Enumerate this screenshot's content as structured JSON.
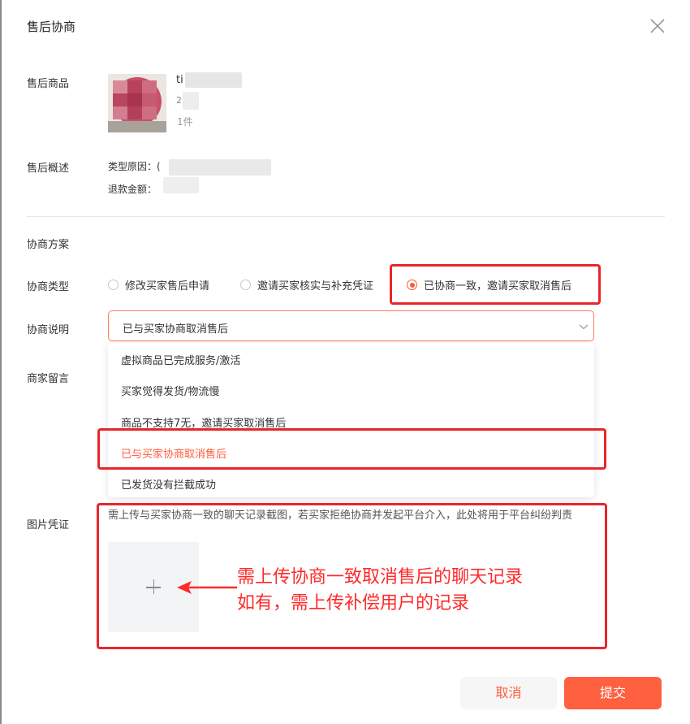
{
  "dialog": {
    "title": "售后协商"
  },
  "labels": {
    "product": "售后商品",
    "summary": "售后概述",
    "plan": "协商方案",
    "type": "协商类型",
    "desc": "协商说明",
    "message": "商家留言",
    "evidence": "图片凭证"
  },
  "product": {
    "name_partial": "ti",
    "line2_partial": "2",
    "quantity": "1件"
  },
  "summary": {
    "reason_label": "类型原因：(",
    "refund_label": "退款金额："
  },
  "type_options": [
    {
      "label": "修改买家售后申请",
      "selected": false
    },
    {
      "label": "邀请买家核实与补充凭证",
      "selected": false
    },
    {
      "label": "已协商一致，邀请买家取消售后",
      "selected": true
    }
  ],
  "description": {
    "selected": "已与买家协商取消售后",
    "options": [
      {
        "label": "虚拟商品已完成服务/激活",
        "active": false
      },
      {
        "label": "买家觉得发货/物流慢",
        "active": false
      },
      {
        "label": "商品不支持7无，邀请买家取消售后",
        "active": false
      },
      {
        "label": "已与买家协商取消售后",
        "active": true
      },
      {
        "label": "已发货没有拦截成功",
        "active": false
      }
    ]
  },
  "evidence": {
    "hint": "需上传与买家协商一致的聊天记录截图，若买家拒绝协商并发起平台介入，此处将用于平台纠纷判责"
  },
  "annotation": {
    "line1": "需上传协商一致取消售后的聊天记录",
    "line2": "如有，需上传补偿用户的记录"
  },
  "buttons": {
    "cancel": "取消",
    "submit": "提交"
  },
  "colors": {
    "accent": "#ff5c3a",
    "highlight": "#e8262a",
    "annotation": "#ff2a2a",
    "submit_bg": "#ff6040"
  }
}
